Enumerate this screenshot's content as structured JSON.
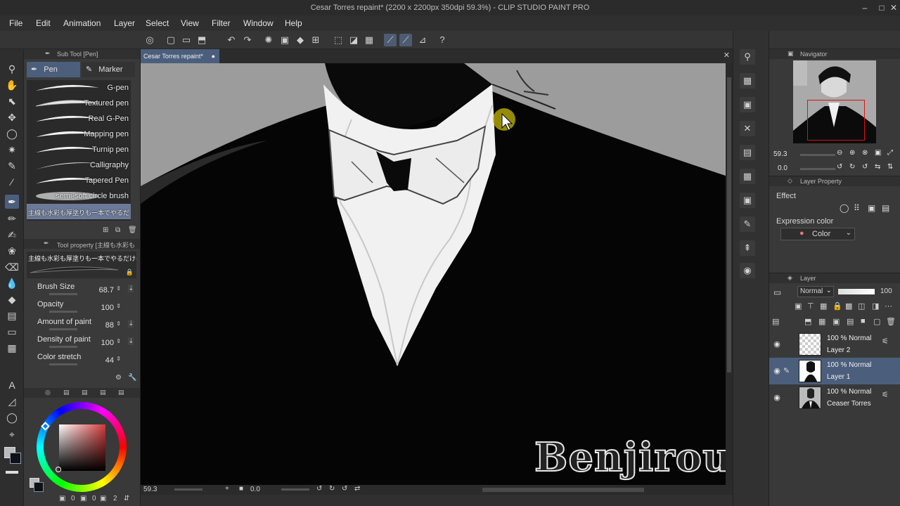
{
  "window": {
    "title": "Cesar Torres repaint* (2200 x 2200px 350dpi 59.3%) - CLIP STUDIO PAINT PRO",
    "min_icon": "minimize-icon",
    "max_icon": "maximize-icon",
    "close_icon": "close-icon"
  },
  "menu": [
    "File",
    "Edit",
    "Animation",
    "Layer",
    "Select",
    "View",
    "Filter",
    "Window",
    "Help"
  ],
  "subtool": {
    "header": "Sub Tool [Pen]",
    "tabs": [
      {
        "label": "Pen",
        "active": true
      },
      {
        "label": "Marker",
        "active": false
      }
    ],
    "brushes": [
      {
        "label": "G-pen",
        "active": false
      },
      {
        "label": "Textured pen",
        "active": false
      },
      {
        "label": "Real G-Pen",
        "active": false
      },
      {
        "label": "Mapping pen",
        "active": false
      },
      {
        "label": "Turnip pen",
        "active": false
      },
      {
        "label": "Calligraphy",
        "active": false
      },
      {
        "label": "Tapered Pen",
        "active": false
      },
      {
        "label": "semi-soft circle brush",
        "active": false
      },
      {
        "label": "主線も水彩も厚塗りも一本でやるだけの",
        "active": true
      }
    ]
  },
  "toolprop": {
    "header": "Tool property [主線も水彩も",
    "brush_name": "主線も水彩も厚塗りも一本でやるだけのブラシ",
    "properties": [
      {
        "name": "Brush Size",
        "value": "68.7"
      },
      {
        "name": "Opacity",
        "value": "100"
      },
      {
        "name": "Amount of paint",
        "value": "88"
      },
      {
        "name": "Density of paint",
        "value": "100"
      },
      {
        "name": "Color stretch",
        "value": "44"
      }
    ]
  },
  "colorpanel": {
    "hue_color": "#e03a3a",
    "values": [
      "0",
      "0",
      "2"
    ]
  },
  "canvas": {
    "tab_label": "Cesar Torres repaint*",
    "zoom": "59.3",
    "angle": "0.0",
    "watermark": "Benjirou"
  },
  "navigator": {
    "title": "Navigator",
    "zoom": "59.3",
    "angle": "0.0"
  },
  "layerprop": {
    "title": "Layer Property",
    "effect_label": "Effect",
    "expression_label": "Expression color",
    "expression_value": "Color"
  },
  "layers": {
    "title": "Layer",
    "blend_mode": "Normal",
    "opacity": "100",
    "items": [
      {
        "mode": "100 % Normal",
        "name": "Layer 2",
        "active": false
      },
      {
        "mode": "100 % Normal",
        "name": "Layer 1",
        "active": true
      },
      {
        "mode": "100 % Normal",
        "name": "Ceaser Torres",
        "active": false
      }
    ]
  }
}
